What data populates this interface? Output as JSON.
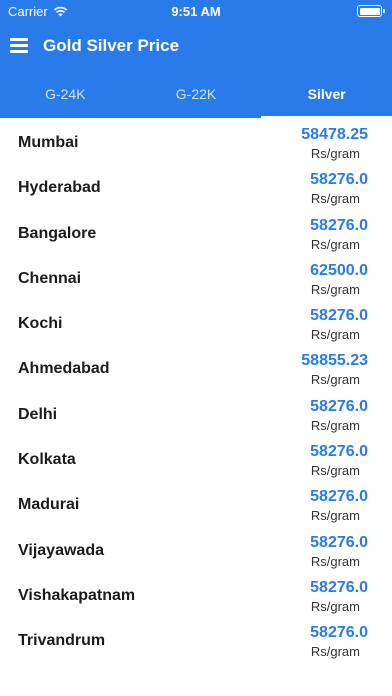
{
  "status_bar": {
    "carrier": "Carrier",
    "time": "9:51 AM"
  },
  "app_bar": {
    "title": "Gold Silver Price",
    "menu_icon": "hamburger-menu-icon"
  },
  "tabs": [
    {
      "label": "G-24K",
      "active": false
    },
    {
      "label": "G-22K",
      "active": false
    },
    {
      "label": "Silver",
      "active": true
    }
  ],
  "colors": {
    "primary": "#2a7bea",
    "price": "#2a7bea"
  },
  "rates": [
    {
      "city": "Mumbai",
      "price": "58478.25",
      "unit": "Rs/gram"
    },
    {
      "city": "Hyderabad",
      "price": "58276.0",
      "unit": "Rs/gram"
    },
    {
      "city": "Bangalore",
      "price": "58276.0",
      "unit": "Rs/gram"
    },
    {
      "city": "Chennai",
      "price": "62500.0",
      "unit": "Rs/gram"
    },
    {
      "city": "Kochi",
      "price": "58276.0",
      "unit": "Rs/gram"
    },
    {
      "city": "Ahmedabad",
      "price": "58855.23",
      "unit": "Rs/gram"
    },
    {
      "city": "Delhi",
      "price": "58276.0",
      "unit": "Rs/gram"
    },
    {
      "city": "Kolkata",
      "price": "58276.0",
      "unit": "Rs/gram"
    },
    {
      "city": "Madurai",
      "price": "58276.0",
      "unit": "Rs/gram"
    },
    {
      "city": "Vijayawada",
      "price": "58276.0",
      "unit": "Rs/gram"
    },
    {
      "city": "Vishakapatnam",
      "price": "58276.0",
      "unit": "Rs/gram"
    },
    {
      "city": "Trivandrum",
      "price": "58276.0",
      "unit": "Rs/gram"
    }
  ]
}
